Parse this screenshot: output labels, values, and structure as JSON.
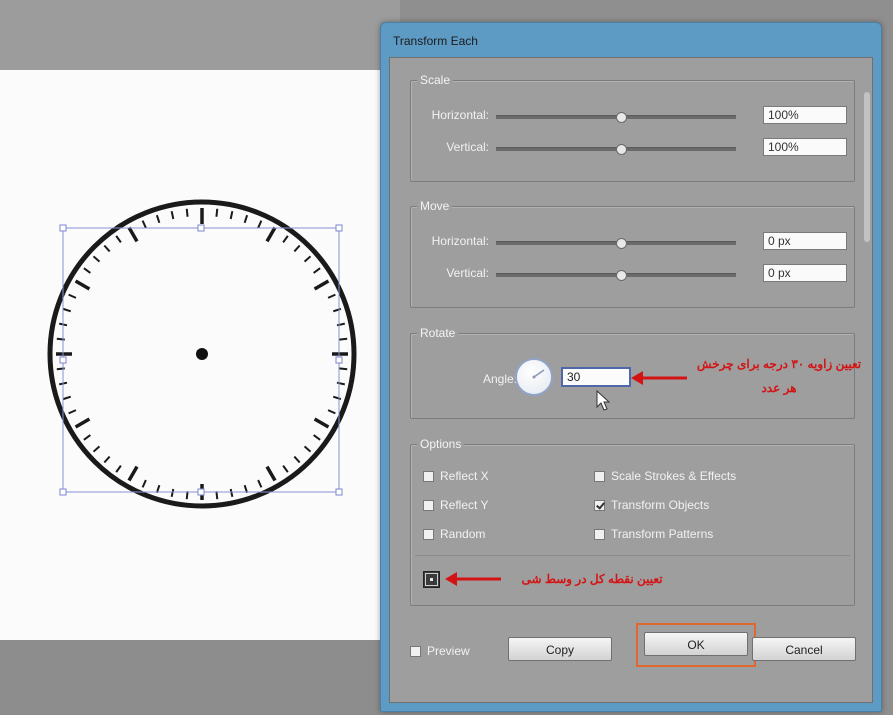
{
  "dialog": {
    "title": "Transform Each",
    "scale": {
      "title": "Scale",
      "horizontal_label": "Horizontal:",
      "horizontal_value": "100%",
      "horizontal_slider": 0.52,
      "vertical_label": "Vertical:",
      "vertical_value": "100%",
      "vertical_slider": 0.52
    },
    "move": {
      "title": "Move",
      "horizontal_label": "Horizontal:",
      "horizontal_value": "0 px",
      "horizontal_slider": 0.52,
      "vertical_label": "Vertical:",
      "vertical_value": "0 px",
      "vertical_slider": 0.52
    },
    "rotate": {
      "title": "Rotate",
      "angle_label": "Angle:",
      "angle_value": "30"
    },
    "options": {
      "title": "Options",
      "reflect_x": {
        "label": "Reflect X",
        "checked": false
      },
      "reflect_y": {
        "label": "Reflect Y",
        "checked": false
      },
      "random": {
        "label": "Random",
        "checked": false
      },
      "scale_strokes": {
        "label": "Scale Strokes & Effects",
        "checked": false
      },
      "transform_objects": {
        "label": "Transform Objects",
        "checked": true
      },
      "transform_patterns": {
        "label": "Transform Patterns",
        "checked": false
      }
    },
    "preview": {
      "label": "Preview",
      "checked": false
    },
    "buttons": {
      "copy": "Copy",
      "ok": "OK",
      "cancel": "Cancel"
    }
  },
  "annotations": {
    "rotate_note_line1": "تعیین زاویه ۳۰ درجه برای چرخش",
    "rotate_note_line2": "هر عدد",
    "reference_note": "تعیین نقطه کل در وسط شی"
  },
  "colors": {
    "annotation": "#d41414",
    "ok_highlight": "#e0682f",
    "dialog_frame": "#5d9ac4",
    "dialog_body": "#9e9e9e"
  }
}
